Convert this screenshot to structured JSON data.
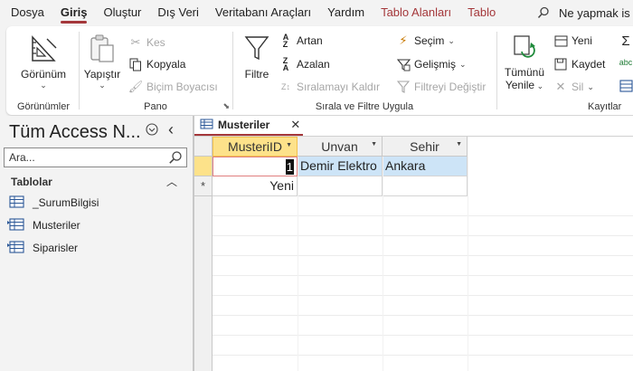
{
  "menubar": {
    "items": [
      "Dosya",
      "Giriş",
      "Oluştur",
      "Dış Veri",
      "Veritabanı Araçları",
      "Yardım",
      "Tablo Alanları",
      "Tablo"
    ],
    "tell_me": "Ne yapmak is"
  },
  "ribbon": {
    "views": {
      "view_label": "Görünüm",
      "group": "Görünümler"
    },
    "clipboard": {
      "paste": "Yapıştır",
      "cut": "Kes",
      "copy": "Kopyala",
      "format_painter": "Biçim Boyacısı",
      "group": "Pano"
    },
    "sort_filter": {
      "filter": "Filtre",
      "ascending": "Artan",
      "descending": "Azalan",
      "remove_sort": "Sıralamayı Kaldır",
      "selection": "Seçim",
      "advanced": "Gelişmiş",
      "toggle_filter": "Filtreyi Değiştir",
      "group": "Sırala ve Filtre Uygula"
    },
    "records": {
      "refresh_all_1": "Tümünü",
      "refresh_all_2": "Yenile",
      "new": "Yeni",
      "save": "Kaydet",
      "delete": "Sil",
      "group": "Kayıtlar",
      "spell_text": "abc"
    }
  },
  "nav": {
    "title": "Tüm Access N...",
    "search_placeholder": "Ara...",
    "section": "Tablolar",
    "items": [
      "_SurumBilgisi",
      "Musteriler",
      "Siparisler"
    ]
  },
  "document": {
    "tab_label": "Musteriler",
    "columns": [
      "MusteriID",
      "Unvan",
      "Sehir"
    ],
    "row": {
      "id": "1",
      "unvan": "Demir Elektro",
      "sehir": "Ankara"
    },
    "new_row_label": "Yeni",
    "new_row_marker": "*"
  }
}
